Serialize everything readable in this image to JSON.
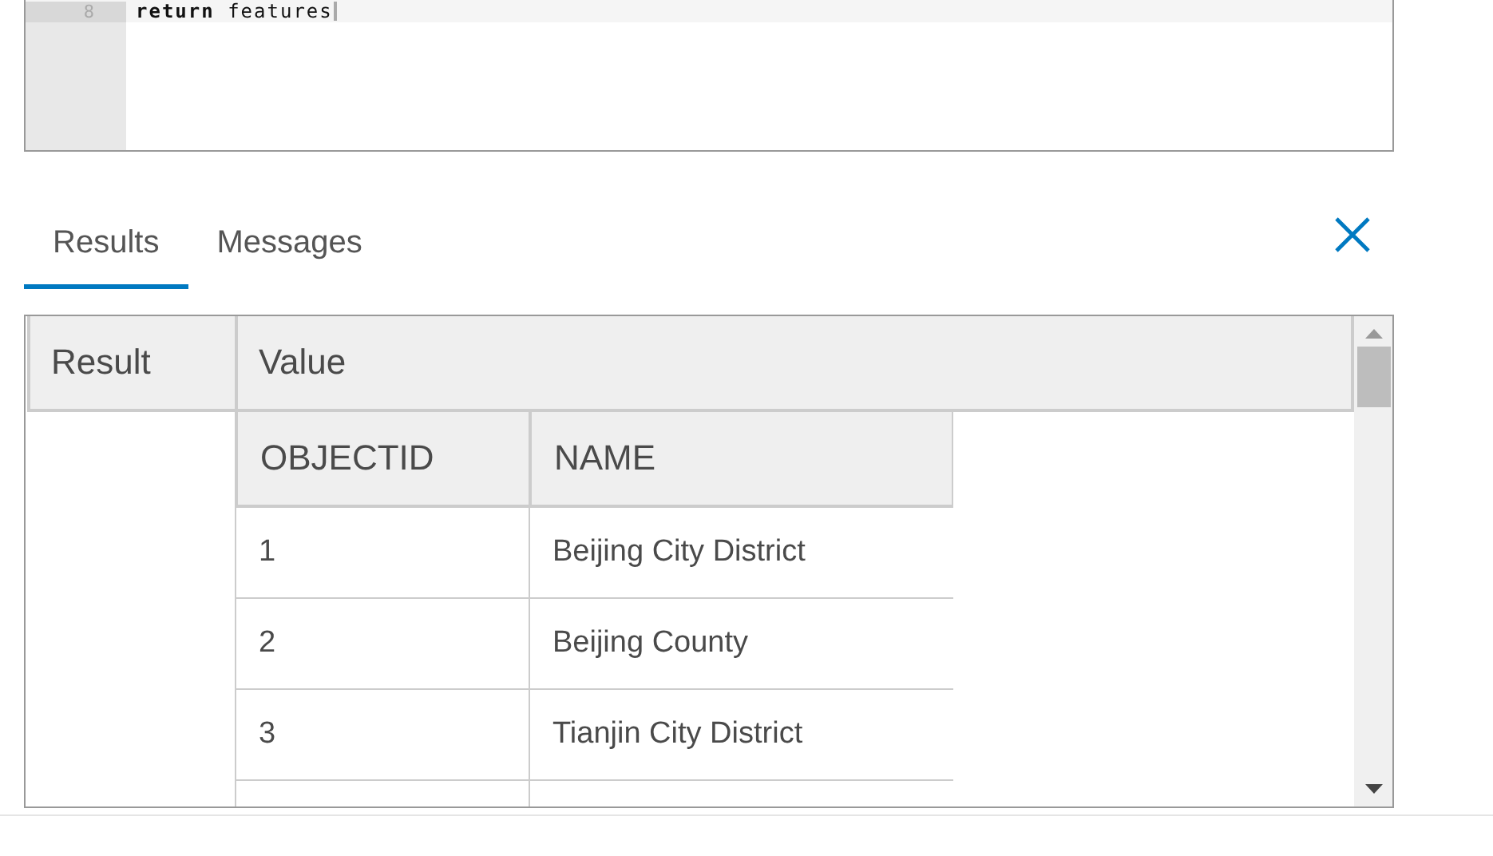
{
  "editor": {
    "lines": [
      {
        "number": "8",
        "code": "**return** features",
        "current": true
      }
    ]
  },
  "tabs": [
    {
      "label": "Results",
      "selected": true
    },
    {
      "label": "Messages",
      "selected": false
    }
  ],
  "results": {
    "columns": [
      "Result",
      "Value"
    ],
    "value_table": {
      "columns": [
        "OBJECTID",
        "NAME"
      ],
      "rows": [
        [
          "1",
          "Beijing City District"
        ],
        [
          "2",
          "Beijing County"
        ],
        [
          "3",
          "Tianjin City District"
        ],
        [
          "",
          ""
        ]
      ]
    }
  }
}
